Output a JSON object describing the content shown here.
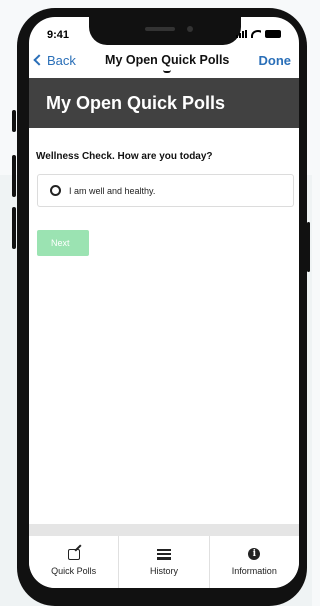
{
  "status": {
    "time": "9:41"
  },
  "nav": {
    "back_label": "Back",
    "title": "My Open Quick Polls",
    "done_label": "Done"
  },
  "header": {
    "title": "My Open Quick Polls"
  },
  "poll": {
    "question": "Wellness Check. How are you today?",
    "options": [
      {
        "label": "I am well and healthy.",
        "selected": false
      }
    ],
    "next_label": "Next"
  },
  "tabs": [
    {
      "label": "Quick Polls",
      "icon": "edit-icon"
    },
    {
      "label": "History",
      "icon": "list-icon"
    },
    {
      "label": "Information",
      "icon": "info-icon"
    }
  ],
  "colors": {
    "accent": "#2a6fb8",
    "header_bg": "#414141",
    "next_disabled": "#9be3b2"
  }
}
